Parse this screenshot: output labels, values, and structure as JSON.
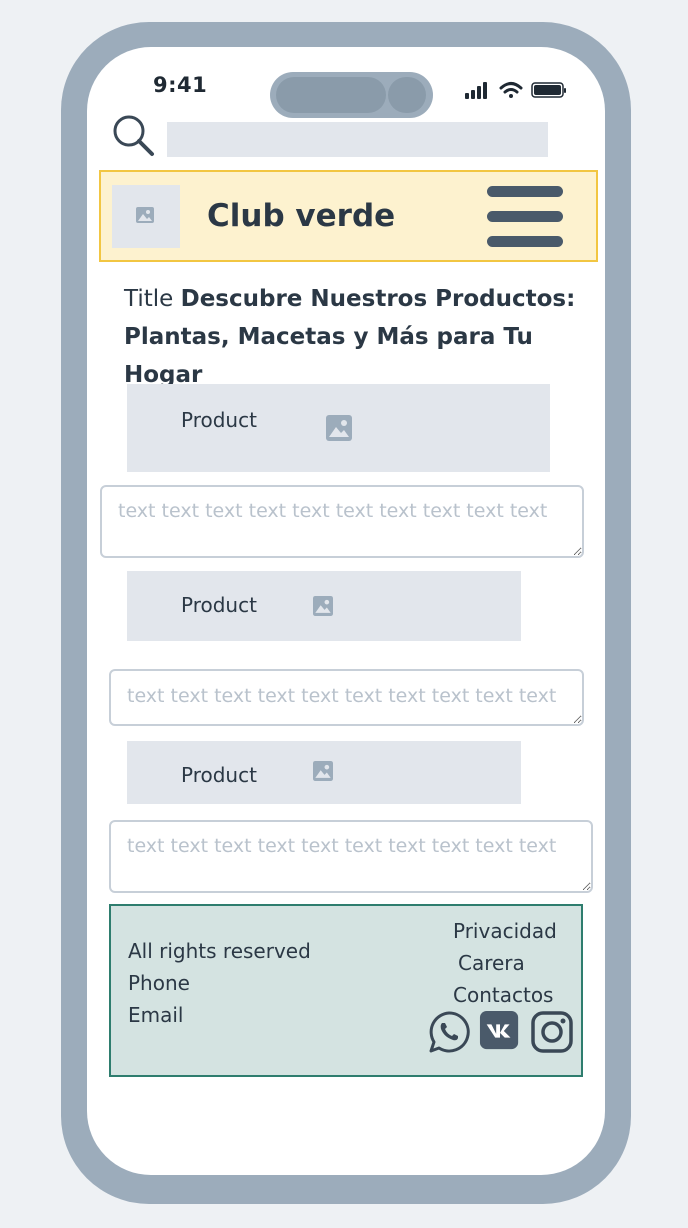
{
  "status_bar": {
    "time": "9:41"
  },
  "search": {
    "placeholder": ""
  },
  "header": {
    "brand": "Club verde"
  },
  "title": {
    "prefix": "Title",
    "text": "Descubre Nuestros Productos: Plantas, Macetas y Más para Tu Hogar"
  },
  "products": [
    {
      "label": "Product",
      "text_placeholder": "text text text text text text text text text text"
    },
    {
      "label": "Product",
      "text_placeholder": "text text text text text text text text text text"
    },
    {
      "label": "Product",
      "text_placeholder": "text text text text text text text text text text"
    }
  ],
  "footer": {
    "rights": "All rights reserved",
    "phone": "Phone",
    "email": "Email",
    "links": [
      "Privacidad",
      "Carera",
      "Contactos"
    ],
    "social_icons": [
      "whatsapp-icon",
      "vk-icon",
      "instagram-icon"
    ]
  },
  "colors": {
    "header_bg": "#fdf2cf",
    "header_border": "#f2c642",
    "footer_bg": "#d4e3e1",
    "footer_border": "#2e7d6e",
    "phone_frame": "#9cacbb",
    "placeholder_block": "#e2e6ec"
  }
}
